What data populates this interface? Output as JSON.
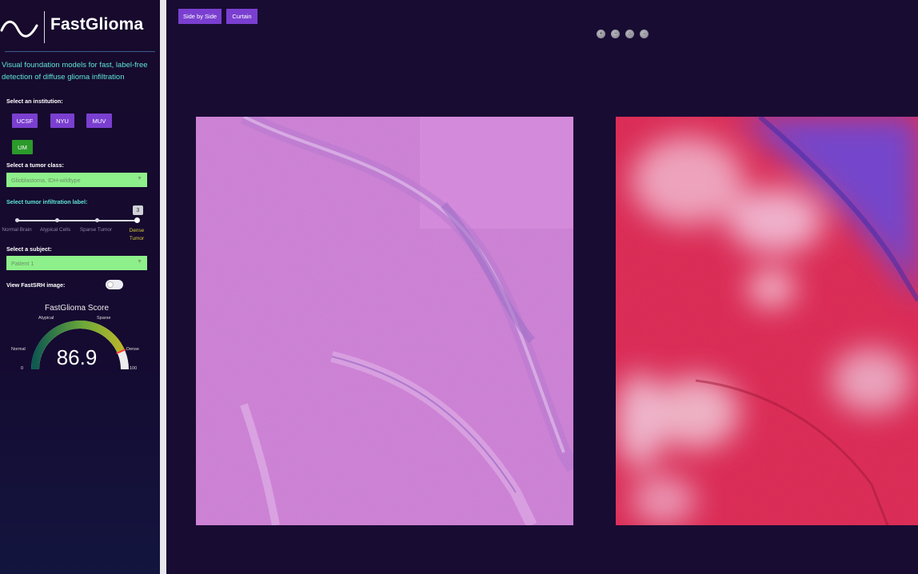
{
  "app": {
    "brand": "FastGlioma",
    "tagline": "Visual foundation models for fast, label-free detection of diffuse glioma infiltration"
  },
  "institution": {
    "label": "Select an institution:",
    "options": [
      {
        "label": "UCSF",
        "active": false
      },
      {
        "label": "NYU",
        "active": false
      },
      {
        "label": "MUV",
        "active": false
      },
      {
        "label": "UM",
        "active": true
      }
    ]
  },
  "tumor_class": {
    "label": "Select a tumor class:",
    "value": "Glioblastoma, IDH-wildtype"
  },
  "infiltration": {
    "label": "Select tumor infiltration label:",
    "selected_index": 3,
    "tooltip": "3",
    "marks": [
      "Normal Brain",
      "Atypical Cells",
      "Sparse Tumor",
      "Dense Tumor"
    ]
  },
  "subject": {
    "label": "Select a subject:",
    "value": "Patient 1"
  },
  "fastsrh_toggle": {
    "label": "View FastSRH image:",
    "on": false
  },
  "gauge": {
    "title": "FastGlioma Score",
    "value": 86.9,
    "value_text": "86.9",
    "min": 0,
    "max": 100,
    "labels": {
      "normal": "Normal",
      "atypical": "Atypical",
      "sparse": "Sparse",
      "dense": "Dense",
      "min": "0",
      "max": "100"
    },
    "colors": {
      "low": "#1a6e5a",
      "mid": "#8fb833",
      "high": "#b8b52a",
      "track": "#ececec",
      "pointer": "#ff3b3b"
    }
  },
  "viewer": {
    "modes": [
      "Side by Side",
      "Curtain"
    ],
    "tool_icons": [
      "zoom-in-icon",
      "zoom-out-icon",
      "home-icon",
      "fullscreen-icon"
    ]
  },
  "colors": {
    "accent": "#7a3fd0",
    "active": "#2a9a2a",
    "dropdown": "#8ef08a",
    "background": "#190c33",
    "cyan_text": "#5ee4d8"
  }
}
